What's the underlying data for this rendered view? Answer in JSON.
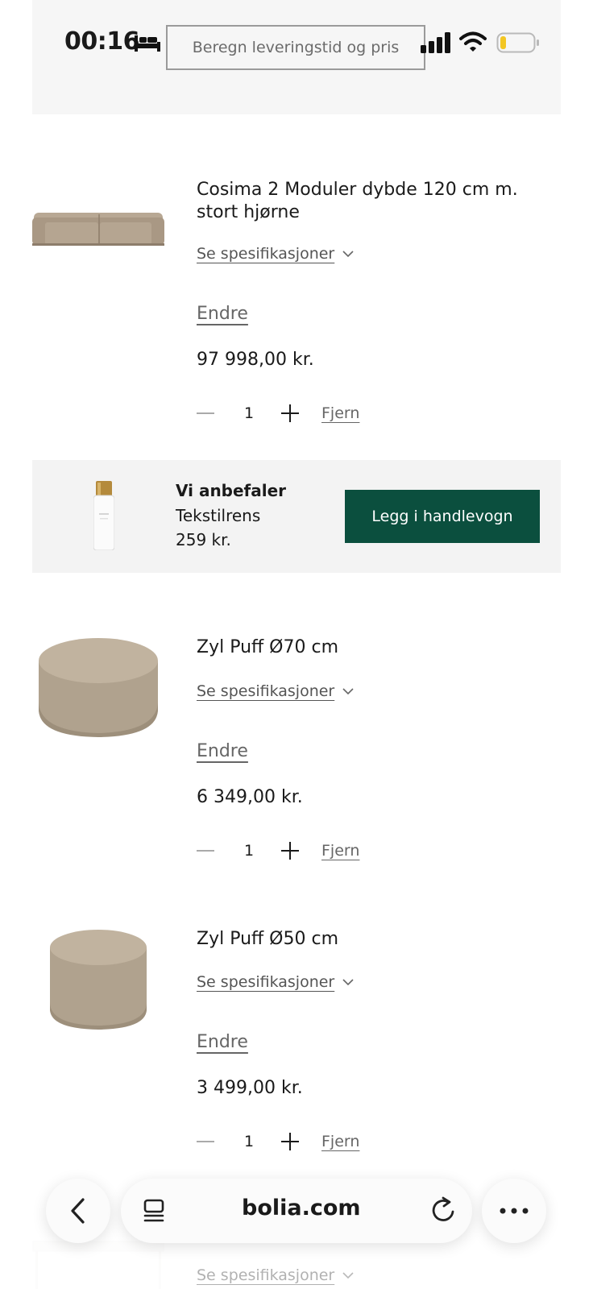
{
  "status_bar": {
    "time": "00:16",
    "search_text": "Beregn leveringstid og pris"
  },
  "products": [
    {
      "title_line1": "Cosima 2 Moduler dybde 120 cm m.",
      "title_line2": "stort hjørne",
      "spec_label": "Se spesifikasjoner",
      "edit_label": "Endre",
      "price": "97 998,00 kr.",
      "quantity": "1",
      "remove_label": "Fjern"
    },
    {
      "title_line1": "Zyl Puff Ø70 cm",
      "spec_label": "Se spesifikasjoner",
      "edit_label": "Endre",
      "price": "6 349,00 kr.",
      "quantity": "1",
      "remove_label": "Fjern"
    },
    {
      "title_line1": "Zyl Puff Ø50 cm",
      "spec_label": "Se spesifikasjoner",
      "edit_label": "Endre",
      "price": "3 499,00 kr.",
      "quantity": "1",
      "remove_label": "Fjern"
    },
    {
      "spec_label": "Se spesifikasjoner"
    }
  ],
  "recommendation": {
    "heading": "Vi anbefaler",
    "name": "Tekstilrens",
    "price": "259 kr.",
    "button_label": "Legg i handlevogn"
  },
  "browser_bar": {
    "url": "bolia.com"
  },
  "colors": {
    "accent_button": "#0b4f3e",
    "panel_bg": "#f3f3f3"
  }
}
